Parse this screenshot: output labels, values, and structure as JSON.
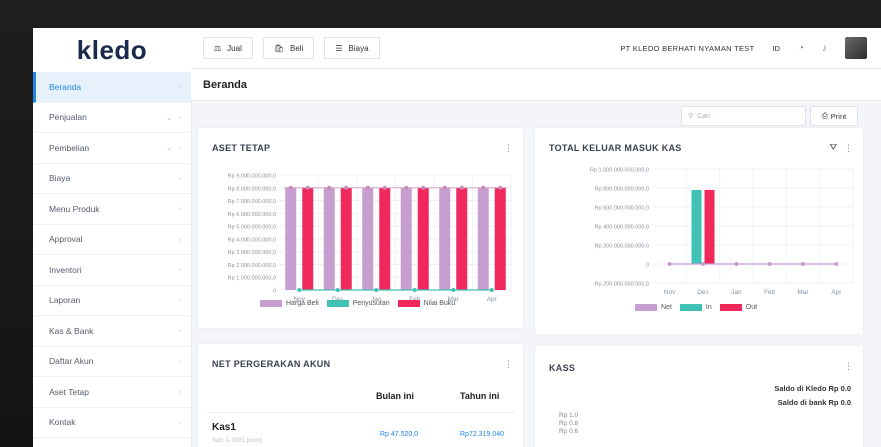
{
  "app": {
    "logo": "kledo"
  },
  "sidebar": {
    "items": [
      {
        "label": "Beranda",
        "active": true,
        "icon": "home-icon"
      },
      {
        "label": "Penjualan",
        "icon": "cart-icon",
        "chevron": true
      },
      {
        "label": "Pembelian",
        "icon": "bag-icon",
        "chevron": true
      },
      {
        "label": "Biaya",
        "icon": "list-icon"
      },
      {
        "label": "Menu Produk",
        "icon": "box-icon"
      },
      {
        "label": "Approval",
        "icon": "check-icon"
      },
      {
        "label": "Inventori",
        "icon": "warehouse-icon"
      },
      {
        "label": "Laporan",
        "icon": "report-icon"
      },
      {
        "label": "Kas & Bank",
        "icon": "dollar-icon"
      },
      {
        "label": "Daftar Akun",
        "icon": "book-icon"
      },
      {
        "label": "Aset Tetap",
        "icon": "asset-icon"
      },
      {
        "label": "Kontak",
        "icon": "contact-icon"
      }
    ]
  },
  "topbar": {
    "buttons": [
      {
        "label": "Jual",
        "icon": "scale-icon"
      },
      {
        "label": "Beli",
        "icon": "basket-icon"
      },
      {
        "label": "Biaya",
        "icon": "list-icon"
      }
    ],
    "company": "PT KLEDO BERHATI NYAMAN TEST",
    "language": "ID"
  },
  "page": {
    "title": "Beranda"
  },
  "toolbar": {
    "search_placeholder": "Cari",
    "print_label": "Print"
  },
  "cards": {
    "aset_tetap": {
      "title": "ASET TETAP"
    },
    "kas": {
      "title": "TOTAL KELUAR MASUK KAS"
    },
    "net": {
      "title": "NET PERGERAKAN AKUN",
      "col_month": "Bulan ini",
      "col_year": "Tahun ini",
      "rows": [
        {
          "name": "Kas1",
          "subtitle": "Sub: 1-1001 (xxxx)",
          "month": "Rp 47.520,0",
          "year": "Rp72.319.040"
        }
      ]
    },
    "kass": {
      "title": "KASS",
      "saldo_kledo": "Saldo di Kledo Rp 0.0",
      "saldo_bank": "Saldo di bank Rp 0.0",
      "ticks": [
        "Rp 1.0",
        "Rp 0.8",
        "Rp 0.6"
      ]
    }
  },
  "colors": {
    "accent": "#1e88e5",
    "purple": "#c79ed0",
    "teal": "#3fc1b5",
    "pink": "#f0285c"
  },
  "chart_data": [
    {
      "type": "bar",
      "title": "ASET TETAP",
      "categories": [
        "Nov",
        "Des",
        "Jan",
        "Feb",
        "Mar",
        "Apr"
      ],
      "y_ticks": [
        "Rp 9.000.000.000,0",
        "Rp 8.000.000.000,0",
        "Rp 7.000.000.000,0",
        "Rp 6.000.000.000,0",
        "Rp 5.000.000.000,0",
        "Rp 4.000.000.000,0",
        "Rp 3.000.000.000,0",
        "Rp 2.000.000.000,0",
        "Rp 1.000.000.000,0",
        "0"
      ],
      "ylim": [
        0,
        9000000000
      ],
      "series": [
        {
          "name": "Harga Beli",
          "type": "bar",
          "color": "#c79ed0",
          "values": [
            8000000000,
            8000000000,
            8000000000,
            8000000000,
            8000000000,
            8000000000
          ]
        },
        {
          "name": "Penyusutan",
          "type": "line",
          "color": "#3fc1b5",
          "values": [
            0,
            0,
            0,
            0,
            0,
            0
          ]
        },
        {
          "name": "Nilai Buku",
          "type": "bar",
          "color": "#f0285c",
          "values": [
            8000000000,
            8000000000,
            8000000000,
            8000000000,
            8000000000,
            8000000000
          ]
        }
      ],
      "legend_position": "bottom"
    },
    {
      "type": "bar",
      "title": "TOTAL KELUAR MASUK KAS",
      "categories": [
        "Nov",
        "Des",
        "Jan",
        "Feb",
        "Mar",
        "Apr"
      ],
      "y_ticks": [
        "Rp 1.000.000.000.000,0",
        "Rp 800.000.000.000,0",
        "Rp 600.000.000.000,0",
        "Rp 400.000.000.000,0",
        "Rp 200.000.000.000,0",
        "0",
        "-Rp 200.000.000.000,0"
      ],
      "ylim": [
        -200000000000,
        1000000000000
      ],
      "series": [
        {
          "name": "Net",
          "type": "line",
          "color": "#c79ed0",
          "values": [
            0,
            0,
            0,
            0,
            0,
            0
          ]
        },
        {
          "name": "In",
          "type": "bar",
          "color": "#3fc1b5",
          "values": [
            0,
            780000000000,
            0,
            0,
            0,
            0
          ]
        },
        {
          "name": "Out",
          "type": "bar",
          "color": "#f0285c",
          "values": [
            0,
            780000000000,
            0,
            0,
            0,
            0
          ]
        }
      ],
      "legend_position": "bottom"
    }
  ]
}
